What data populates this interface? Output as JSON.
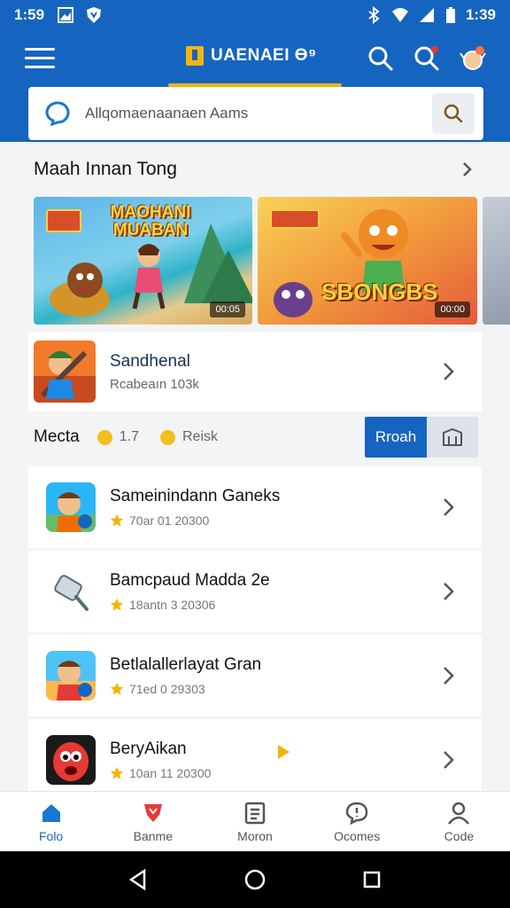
{
  "status_bar": {
    "time_left": "1:59",
    "time_right": "1:39"
  },
  "app_bar": {
    "brand": "UAENAEI ϴ⁹"
  },
  "search": {
    "placeholder": "Allqomaenaanaen Aams"
  },
  "featured": {
    "title": "Maah Innan Tong",
    "banners": [
      {
        "title": "MAOHANI MUABAN",
        "tag": "00:05"
      },
      {
        "title": "SBONGBS",
        "tag": "00:00"
      }
    ]
  },
  "feature_card": {
    "title": "Sandhenal",
    "subtitle": "Rcabeaın 103k"
  },
  "filter": {
    "label": "Mecta",
    "rating": "1.7",
    "secondary": "Reisk",
    "active_tab": "Rroah"
  },
  "games": [
    {
      "title": "Sameinindann Ganeks",
      "meta": "70ar 01 20300"
    },
    {
      "title": "Bamcpaud Madda 2e",
      "meta": "18antn 3 20306"
    },
    {
      "title": "Betlalallerlayat Gran",
      "meta": "71ed 0 29303"
    },
    {
      "title": "BeryAikan",
      "meta": "10an 11 20300"
    }
  ],
  "bottom_nav": [
    {
      "label": "Folo",
      "icon": "home-icon"
    },
    {
      "label": "Banme",
      "icon": "shield-icon"
    },
    {
      "label": "Moron",
      "icon": "list-icon"
    },
    {
      "label": "Ocomes",
      "icon": "chat-icon"
    },
    {
      "label": "Code",
      "icon": "person-icon"
    }
  ],
  "colors": {
    "primary": "#1565c0",
    "accent": "#f6b40e",
    "background": "#f3f4f6"
  }
}
